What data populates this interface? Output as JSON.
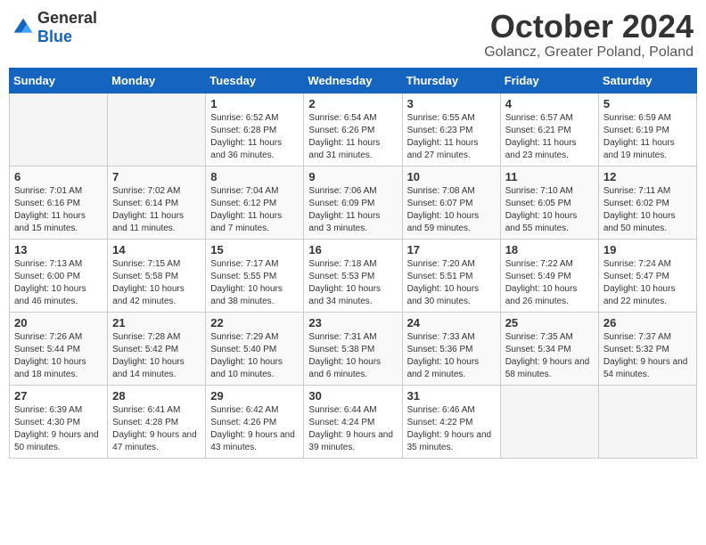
{
  "header": {
    "logo_general": "General",
    "logo_blue": "Blue",
    "month": "October 2024",
    "location": "Golancz, Greater Poland, Poland"
  },
  "weekdays": [
    "Sunday",
    "Monday",
    "Tuesday",
    "Wednesday",
    "Thursday",
    "Friday",
    "Saturday"
  ],
  "weeks": [
    [
      {
        "day": "",
        "sunrise": "",
        "sunset": "",
        "daylight": ""
      },
      {
        "day": "",
        "sunrise": "",
        "sunset": "",
        "daylight": ""
      },
      {
        "day": "1",
        "sunrise": "Sunrise: 6:52 AM",
        "sunset": "Sunset: 6:28 PM",
        "daylight": "Daylight: 11 hours and 36 minutes."
      },
      {
        "day": "2",
        "sunrise": "Sunrise: 6:54 AM",
        "sunset": "Sunset: 6:26 PM",
        "daylight": "Daylight: 11 hours and 31 minutes."
      },
      {
        "day": "3",
        "sunrise": "Sunrise: 6:55 AM",
        "sunset": "Sunset: 6:23 PM",
        "daylight": "Daylight: 11 hours and 27 minutes."
      },
      {
        "day": "4",
        "sunrise": "Sunrise: 6:57 AM",
        "sunset": "Sunset: 6:21 PM",
        "daylight": "Daylight: 11 hours and 23 minutes."
      },
      {
        "day": "5",
        "sunrise": "Sunrise: 6:59 AM",
        "sunset": "Sunset: 6:19 PM",
        "daylight": "Daylight: 11 hours and 19 minutes."
      }
    ],
    [
      {
        "day": "6",
        "sunrise": "Sunrise: 7:01 AM",
        "sunset": "Sunset: 6:16 PM",
        "daylight": "Daylight: 11 hours and 15 minutes."
      },
      {
        "day": "7",
        "sunrise": "Sunrise: 7:02 AM",
        "sunset": "Sunset: 6:14 PM",
        "daylight": "Daylight: 11 hours and 11 minutes."
      },
      {
        "day": "8",
        "sunrise": "Sunrise: 7:04 AM",
        "sunset": "Sunset: 6:12 PM",
        "daylight": "Daylight: 11 hours and 7 minutes."
      },
      {
        "day": "9",
        "sunrise": "Sunrise: 7:06 AM",
        "sunset": "Sunset: 6:09 PM",
        "daylight": "Daylight: 11 hours and 3 minutes."
      },
      {
        "day": "10",
        "sunrise": "Sunrise: 7:08 AM",
        "sunset": "Sunset: 6:07 PM",
        "daylight": "Daylight: 10 hours and 59 minutes."
      },
      {
        "day": "11",
        "sunrise": "Sunrise: 7:10 AM",
        "sunset": "Sunset: 6:05 PM",
        "daylight": "Daylight: 10 hours and 55 minutes."
      },
      {
        "day": "12",
        "sunrise": "Sunrise: 7:11 AM",
        "sunset": "Sunset: 6:02 PM",
        "daylight": "Daylight: 10 hours and 50 minutes."
      }
    ],
    [
      {
        "day": "13",
        "sunrise": "Sunrise: 7:13 AM",
        "sunset": "Sunset: 6:00 PM",
        "daylight": "Daylight: 10 hours and 46 minutes."
      },
      {
        "day": "14",
        "sunrise": "Sunrise: 7:15 AM",
        "sunset": "Sunset: 5:58 PM",
        "daylight": "Daylight: 10 hours and 42 minutes."
      },
      {
        "day": "15",
        "sunrise": "Sunrise: 7:17 AM",
        "sunset": "Sunset: 5:55 PM",
        "daylight": "Daylight: 10 hours and 38 minutes."
      },
      {
        "day": "16",
        "sunrise": "Sunrise: 7:18 AM",
        "sunset": "Sunset: 5:53 PM",
        "daylight": "Daylight: 10 hours and 34 minutes."
      },
      {
        "day": "17",
        "sunrise": "Sunrise: 7:20 AM",
        "sunset": "Sunset: 5:51 PM",
        "daylight": "Daylight: 10 hours and 30 minutes."
      },
      {
        "day": "18",
        "sunrise": "Sunrise: 7:22 AM",
        "sunset": "Sunset: 5:49 PM",
        "daylight": "Daylight: 10 hours and 26 minutes."
      },
      {
        "day": "19",
        "sunrise": "Sunrise: 7:24 AM",
        "sunset": "Sunset: 5:47 PM",
        "daylight": "Daylight: 10 hours and 22 minutes."
      }
    ],
    [
      {
        "day": "20",
        "sunrise": "Sunrise: 7:26 AM",
        "sunset": "Sunset: 5:44 PM",
        "daylight": "Daylight: 10 hours and 18 minutes."
      },
      {
        "day": "21",
        "sunrise": "Sunrise: 7:28 AM",
        "sunset": "Sunset: 5:42 PM",
        "daylight": "Daylight: 10 hours and 14 minutes."
      },
      {
        "day": "22",
        "sunrise": "Sunrise: 7:29 AM",
        "sunset": "Sunset: 5:40 PM",
        "daylight": "Daylight: 10 hours and 10 minutes."
      },
      {
        "day": "23",
        "sunrise": "Sunrise: 7:31 AM",
        "sunset": "Sunset: 5:38 PM",
        "daylight": "Daylight: 10 hours and 6 minutes."
      },
      {
        "day": "24",
        "sunrise": "Sunrise: 7:33 AM",
        "sunset": "Sunset: 5:36 PM",
        "daylight": "Daylight: 10 hours and 2 minutes."
      },
      {
        "day": "25",
        "sunrise": "Sunrise: 7:35 AM",
        "sunset": "Sunset: 5:34 PM",
        "daylight": "Daylight: 9 hours and 58 minutes."
      },
      {
        "day": "26",
        "sunrise": "Sunrise: 7:37 AM",
        "sunset": "Sunset: 5:32 PM",
        "daylight": "Daylight: 9 hours and 54 minutes."
      }
    ],
    [
      {
        "day": "27",
        "sunrise": "Sunrise: 6:39 AM",
        "sunset": "Sunset: 4:30 PM",
        "daylight": "Daylight: 9 hours and 50 minutes."
      },
      {
        "day": "28",
        "sunrise": "Sunrise: 6:41 AM",
        "sunset": "Sunset: 4:28 PM",
        "daylight": "Daylight: 9 hours and 47 minutes."
      },
      {
        "day": "29",
        "sunrise": "Sunrise: 6:42 AM",
        "sunset": "Sunset: 4:26 PM",
        "daylight": "Daylight: 9 hours and 43 minutes."
      },
      {
        "day": "30",
        "sunrise": "Sunrise: 6:44 AM",
        "sunset": "Sunset: 4:24 PM",
        "daylight": "Daylight: 9 hours and 39 minutes."
      },
      {
        "day": "31",
        "sunrise": "Sunrise: 6:46 AM",
        "sunset": "Sunset: 4:22 PM",
        "daylight": "Daylight: 9 hours and 35 minutes."
      },
      {
        "day": "",
        "sunrise": "",
        "sunset": "",
        "daylight": ""
      },
      {
        "day": "",
        "sunrise": "",
        "sunset": "",
        "daylight": ""
      }
    ]
  ]
}
